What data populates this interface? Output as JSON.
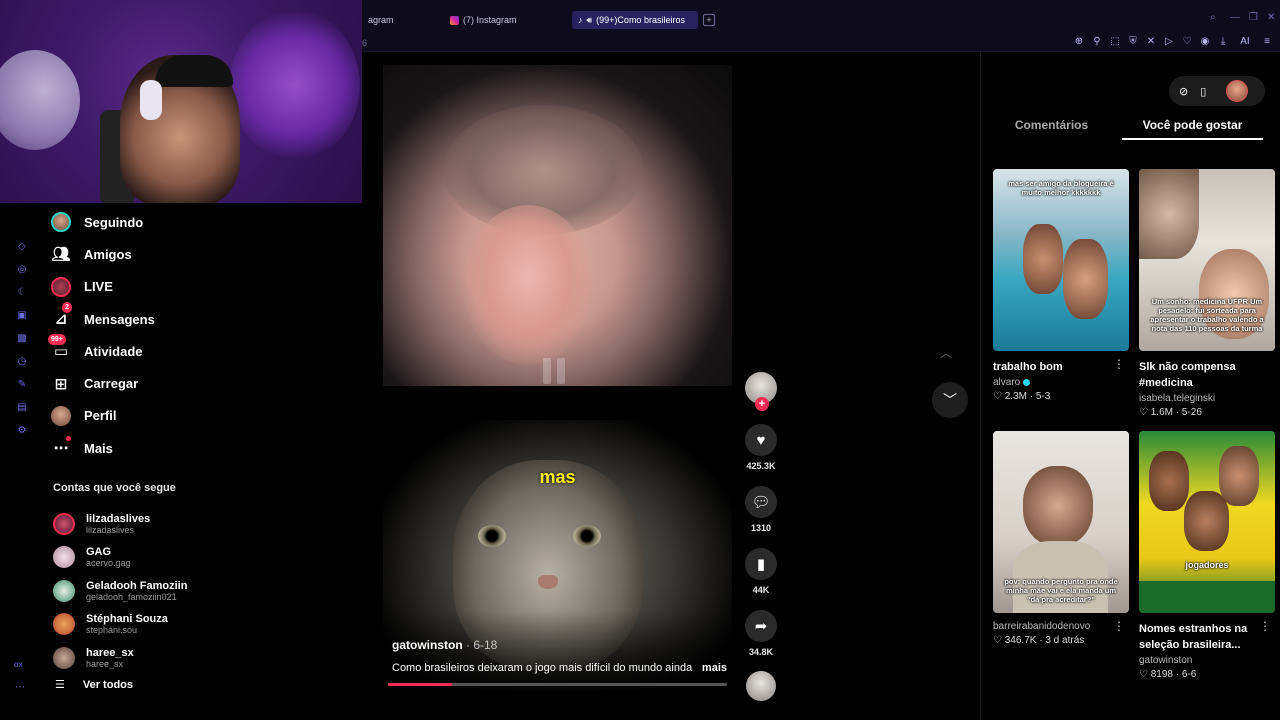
{
  "browser": {
    "tabs": [
      {
        "label": "agram"
      },
      {
        "label": "(7) Instagram"
      },
      {
        "label": "(99+)Como brasileiros"
      }
    ],
    "url_hint": "6",
    "new_tab": "+"
  },
  "sidebar": {
    "items": [
      {
        "label": "Seguindo"
      },
      {
        "label": "Amigos"
      },
      {
        "label": "LIVE"
      },
      {
        "label": "Mensagens",
        "badge": "2"
      },
      {
        "label": "Atividade",
        "badge": "99+"
      },
      {
        "label": "Carregar"
      },
      {
        "label": "Perfil"
      },
      {
        "label": "Mais"
      }
    ],
    "following_title": "Contas que você segue",
    "following": [
      {
        "name": "lilzadaslives",
        "handle": "lilzadaslives"
      },
      {
        "name": "GAG",
        "handle": "acervo.gag"
      },
      {
        "name": "Geladooh Famoziin",
        "handle": "geladooh_famoziin021"
      },
      {
        "name": "Stéphani Souza",
        "handle": "stephani.sou"
      },
      {
        "name": "haree_sx",
        "handle": "haree_sx"
      }
    ],
    "see_all": "Ver todos",
    "rail_label": "αx"
  },
  "feed": {
    "caption_word": "mas",
    "author": "gatowinston",
    "date": " · 6-18",
    "description": "Como brasileiros deixaram o jogo mais difícil do mundo ainda",
    "more": "mais",
    "progress": 0.19,
    "likes": "425.3K",
    "comments": "1310",
    "saves": "44K",
    "shares": "34.8K"
  },
  "right_panel": {
    "tabs": [
      "Comentários",
      "Você pode gostar"
    ],
    "active_tab": 1,
    "videos": [
      {
        "title": "trabalho bom",
        "user": "alvaro",
        "verified": true,
        "likes": "2.3M",
        "date": "5-3",
        "overlay": "mas ser amigo da blogueira é muito melhor kkkkkkk"
      },
      {
        "title": "Slk não compensa #medicina",
        "user": "isabela.teleginski",
        "likes": "1.6M",
        "date": "5-26",
        "overlay": "Um sonho: medicina UFPR Um pesadelo: fui sorteada para apresentar o trabalho valendo a nota das 110 pessoas da turma"
      },
      {
        "title": "",
        "user": "barreirabanidodenovo",
        "likes": "346.7K",
        "date": "3 d atrás",
        "overlay": "pov: quando pergunto pra onde minha mãe vai e ela manda um \"dá pra acreditar?\""
      },
      {
        "title": "Nomes estranhos na seleção brasileira...",
        "user": "gatowinston",
        "likes": "8198",
        "date": "6-6",
        "overlay": "jogadores"
      }
    ]
  },
  "colors": {
    "accent": "#fe2c55",
    "brand_purple": "#6e6ae0",
    "verified": "#20d5ec"
  }
}
